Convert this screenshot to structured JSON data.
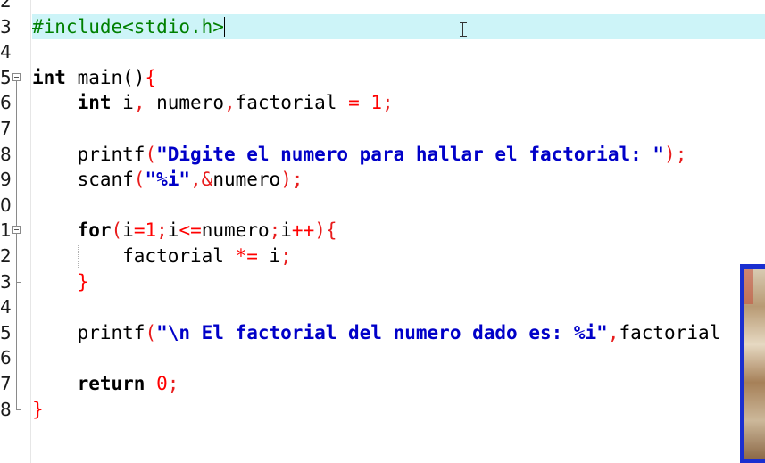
{
  "editor": {
    "language": "C",
    "caret_line": "3",
    "lines": [
      {
        "number": "2",
        "tokens": []
      },
      {
        "number": "3",
        "tokens": [
          {
            "t": "#include<stdio.h>",
            "c": "pp"
          }
        ]
      },
      {
        "number": "4",
        "tokens": []
      },
      {
        "number": "5",
        "tokens": [
          {
            "t": "int",
            "c": "kw"
          },
          {
            "t": " main()",
            "c": ""
          },
          {
            "t": "{",
            "c": "brace"
          }
        ]
      },
      {
        "number": "6",
        "tokens": [
          {
            "t": "    ",
            "c": ""
          },
          {
            "t": "int",
            "c": "kw"
          },
          {
            "t": " i",
            "c": ""
          },
          {
            "t": ",",
            "c": "punc"
          },
          {
            "t": " numero",
            "c": ""
          },
          {
            "t": ",",
            "c": "punc"
          },
          {
            "t": "factorial ",
            "c": ""
          },
          {
            "t": "=",
            "c": "op"
          },
          {
            "t": " ",
            "c": ""
          },
          {
            "t": "1",
            "c": "num"
          },
          {
            "t": ";",
            "c": "punc"
          }
        ]
      },
      {
        "number": "7",
        "tokens": []
      },
      {
        "number": "8",
        "tokens": [
          {
            "t": "    printf",
            "c": ""
          },
          {
            "t": "(",
            "c": "punc"
          },
          {
            "t": "\"Digite el numero para hallar el factorial: \"",
            "c": "str"
          },
          {
            "t": ");",
            "c": "punc"
          }
        ]
      },
      {
        "number": "9",
        "tokens": [
          {
            "t": "    scanf",
            "c": ""
          },
          {
            "t": "(",
            "c": "punc"
          },
          {
            "t": "\"%i\"",
            "c": "str"
          },
          {
            "t": ",&",
            "c": "punc"
          },
          {
            "t": "numero",
            "c": ""
          },
          {
            "t": ");",
            "c": "punc"
          }
        ]
      },
      {
        "number": "0",
        "tokens": []
      },
      {
        "number": "1",
        "tokens": [
          {
            "t": "    ",
            "c": ""
          },
          {
            "t": "for",
            "c": "kw"
          },
          {
            "t": "(",
            "c": "punc"
          },
          {
            "t": "i",
            "c": ""
          },
          {
            "t": "=",
            "c": "op"
          },
          {
            "t": "1",
            "c": "num"
          },
          {
            "t": ";",
            "c": "punc"
          },
          {
            "t": "i",
            "c": ""
          },
          {
            "t": "<=",
            "c": "op"
          },
          {
            "t": "numero",
            "c": ""
          },
          {
            "t": ";",
            "c": "punc"
          },
          {
            "t": "i",
            "c": ""
          },
          {
            "t": "++",
            "c": "op"
          },
          {
            "t": "){",
            "c": "punc"
          }
        ]
      },
      {
        "number": "2",
        "tokens": [
          {
            "t": "        factorial ",
            "c": ""
          },
          {
            "t": "*=",
            "c": "op"
          },
          {
            "t": " i",
            "c": ""
          },
          {
            "t": ";",
            "c": "punc"
          }
        ]
      },
      {
        "number": "3",
        "tokens": [
          {
            "t": "    ",
            "c": ""
          },
          {
            "t": "}",
            "c": "brace"
          }
        ]
      },
      {
        "number": "4",
        "tokens": []
      },
      {
        "number": "5",
        "tokens": [
          {
            "t": "    printf",
            "c": ""
          },
          {
            "t": "(",
            "c": "punc"
          },
          {
            "t": "\"\\n El factorial del numero dado es: %i\"",
            "c": "str"
          },
          {
            "t": ",",
            "c": "punc"
          },
          {
            "t": "factorial",
            "c": ""
          }
        ]
      },
      {
        "number": "6",
        "tokens": []
      },
      {
        "number": "7",
        "tokens": [
          {
            "t": "    ",
            "c": ""
          },
          {
            "t": "return",
            "c": "kw"
          },
          {
            "t": " ",
            "c": ""
          },
          {
            "t": "0",
            "c": "num"
          },
          {
            "t": ";",
            "c": "punc"
          }
        ]
      },
      {
        "number": "8",
        "tokens": [
          {
            "t": "}",
            "c": "brace"
          }
        ]
      }
    ]
  },
  "colors": {
    "current_line_highlight": "#cdf4f8",
    "preprocessor": "#008000",
    "string": "#0000c8",
    "operator": "#ff0000",
    "webcam_border": "#1a2fd0"
  },
  "icons": {
    "cursor": "ibeam-cursor-icon",
    "fold": "fold-collapse-icon"
  }
}
